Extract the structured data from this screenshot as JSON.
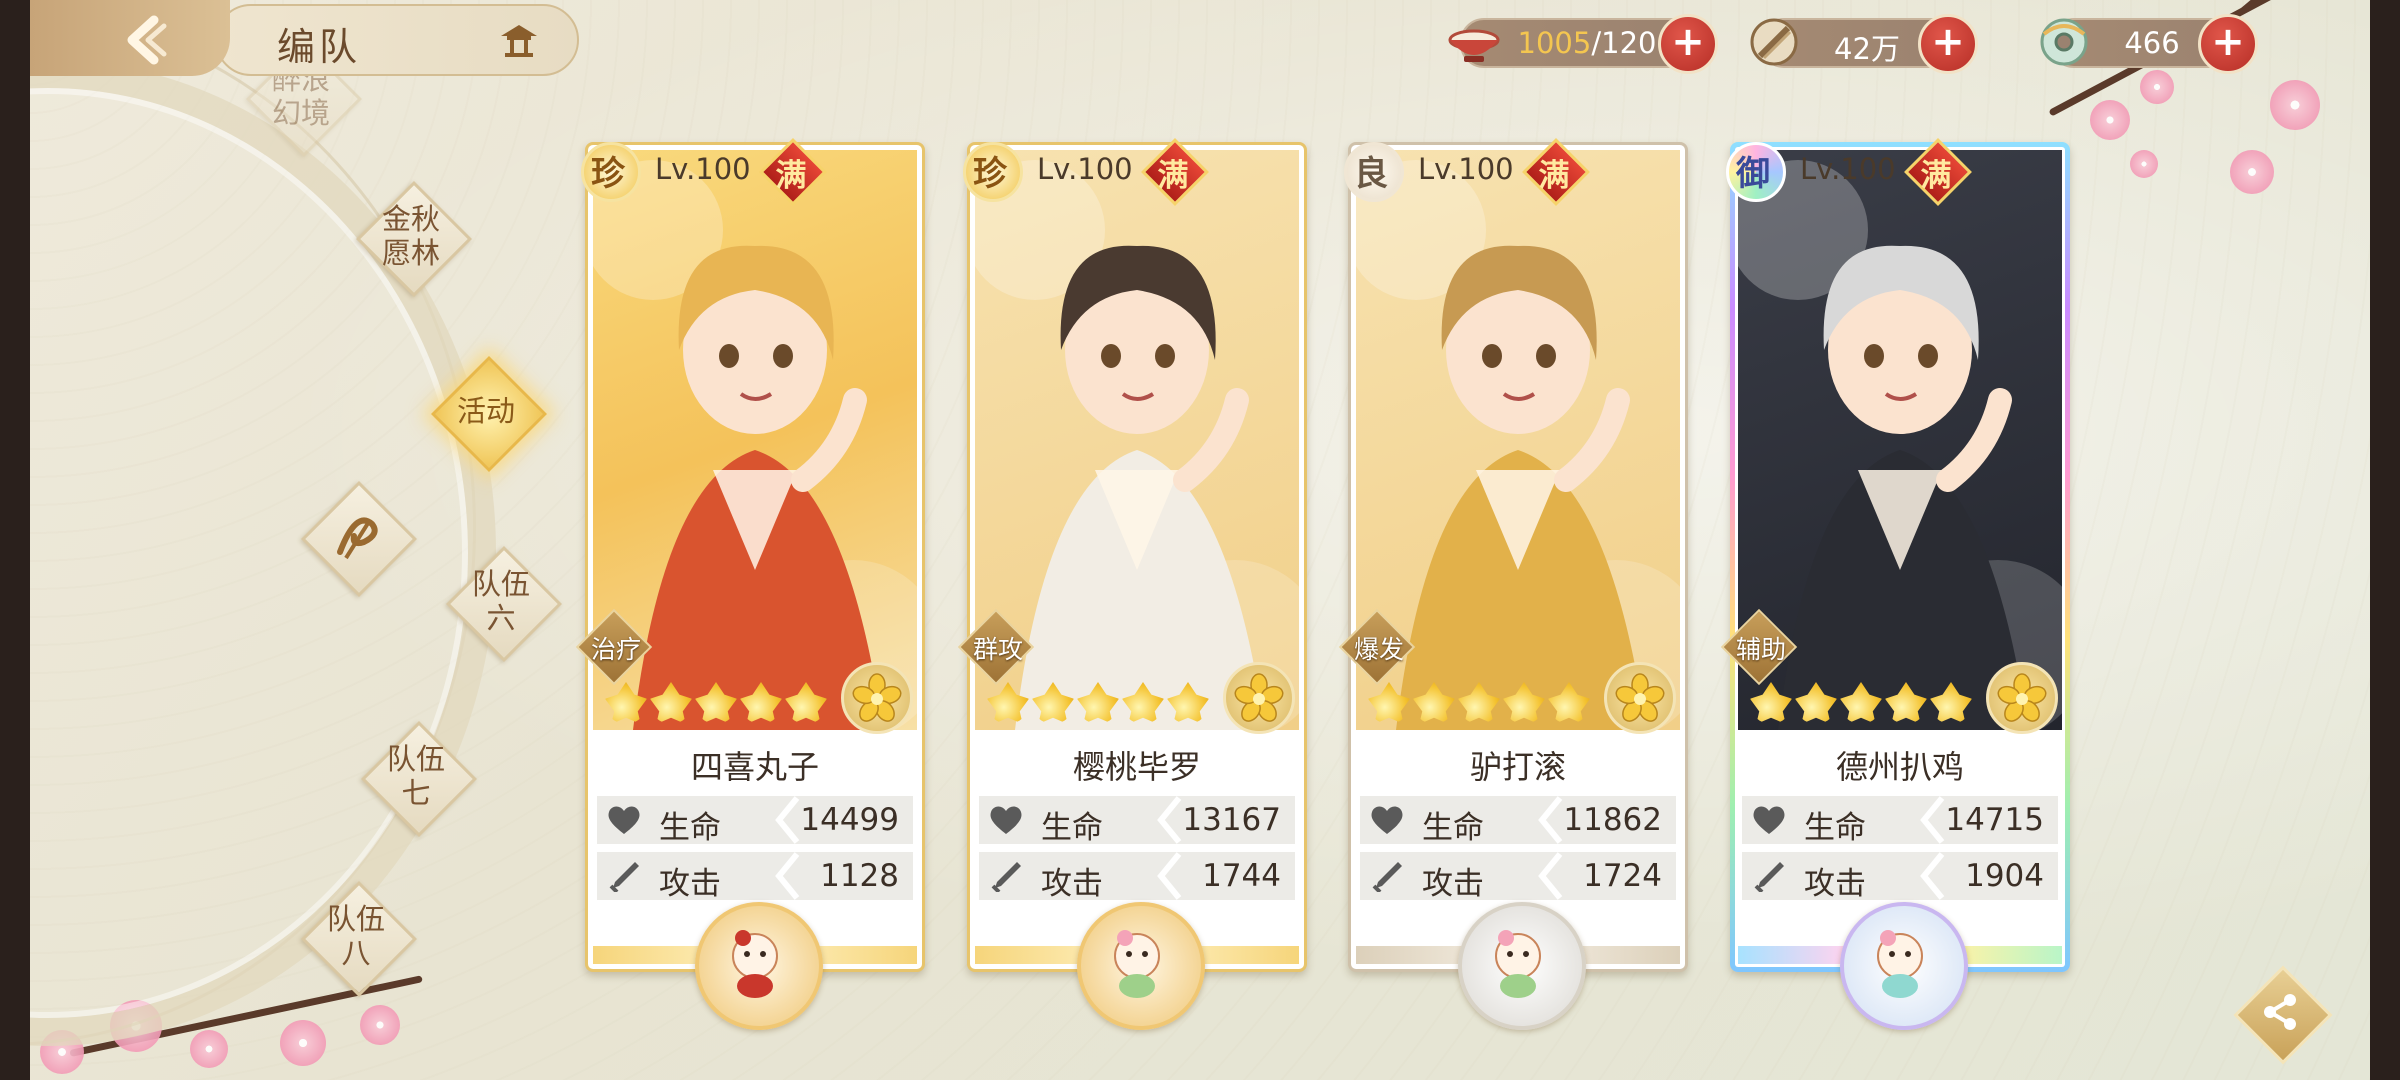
{
  "header": {
    "title": "编队",
    "resources": [
      {
        "name": "stamina",
        "current": "1005",
        "max": "/120",
        "icon": "bowl-icon"
      },
      {
        "name": "coins",
        "value": "42万",
        "icon": "coin-icon"
      },
      {
        "name": "gems",
        "value": "466",
        "icon": "jade-icon"
      }
    ],
    "plus_label": "+"
  },
  "nav": {
    "items": [
      {
        "label": "醉浪\n幻境",
        "state": "faded"
      },
      {
        "label": "金秋\n愿林",
        "state": "normal"
      },
      {
        "label": "活动",
        "state": "active"
      },
      {
        "label": "队伍\n六",
        "state": "normal"
      },
      {
        "label": "队伍\n七",
        "state": "normal"
      },
      {
        "label": "队伍\n八",
        "state": "normal"
      }
    ]
  },
  "cards": [
    {
      "rarity": "珍",
      "level": "Lv.100",
      "max_tag": "满",
      "role": "治疗",
      "stars": 5,
      "name": "四喜丸子",
      "hp_label": "生命",
      "hp": "14499",
      "atk_label": "攻击",
      "atk": "1128"
    },
    {
      "rarity": "珍",
      "level": "Lv.100",
      "max_tag": "满",
      "role": "群攻",
      "stars": 5,
      "name": "樱桃毕罗",
      "hp_label": "生命",
      "hp": "13167",
      "atk_label": "攻击",
      "atk": "1744"
    },
    {
      "rarity": "良",
      "level": "Lv.100",
      "max_tag": "满",
      "role": "爆发",
      "stars": 5,
      "name": "驴打滚",
      "hp_label": "生命",
      "hp": "11862",
      "atk_label": "攻击",
      "atk": "1724"
    },
    {
      "rarity": "御",
      "level": "Lv.100",
      "max_tag": "满",
      "role": "辅助",
      "stars": 5,
      "name": "德州扒鸡",
      "hp_label": "生命",
      "hp": "14715",
      "atk_label": "攻击",
      "atk": "1904"
    }
  ],
  "colors": {
    "accent_gold": "#f0c658",
    "max_red": "#d0312a",
    "text_dark": "#3b2f26"
  }
}
